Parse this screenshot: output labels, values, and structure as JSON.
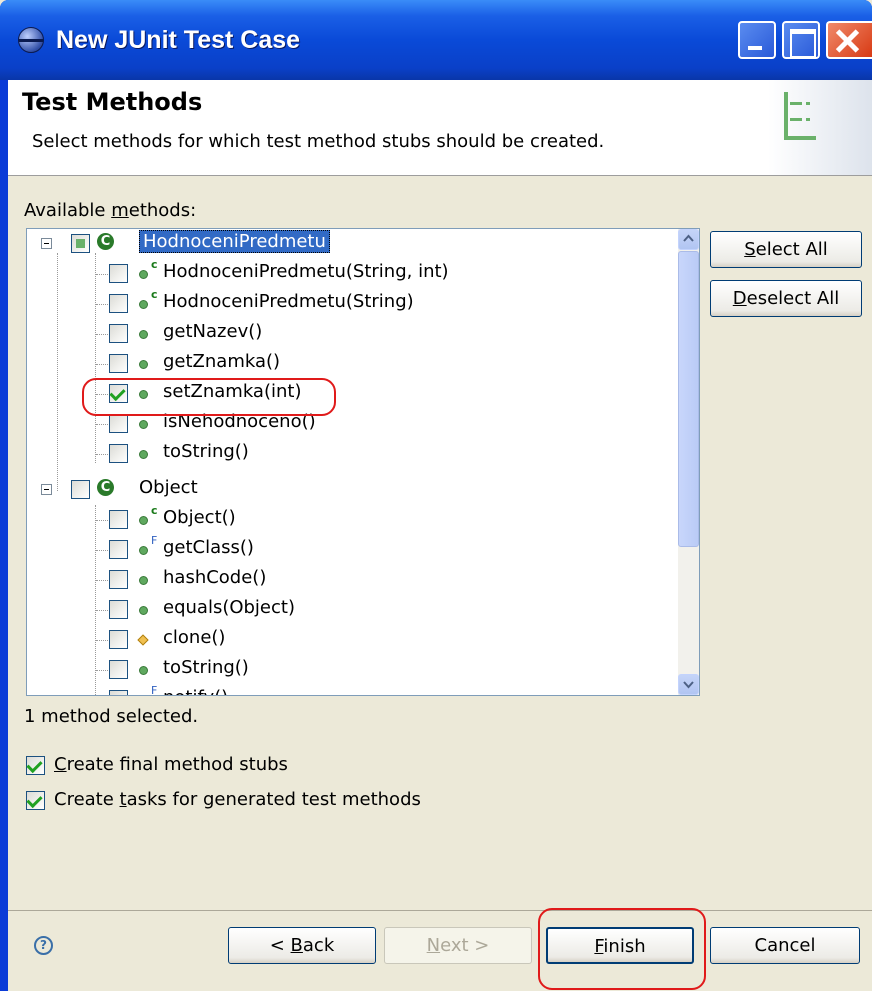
{
  "window": {
    "title": "New JUnit Test Case"
  },
  "header": {
    "title": "Test Methods",
    "description": "Select methods for which test method stubs should be created."
  },
  "available_label": {
    "before": "Available ",
    "mnemonic": "m",
    "after": "ethods:"
  },
  "tree": {
    "class1": {
      "name": "HodnoceniPredmetu",
      "icon_letter": "C"
    },
    "class1_methods": [
      {
        "label": "HodnoceniPredmetu(String, int)",
        "checked": false,
        "marker": "c"
      },
      {
        "label": "HodnoceniPredmetu(String)",
        "checked": false,
        "marker": "c"
      },
      {
        "label": "getNazev()",
        "checked": false
      },
      {
        "label": "getZnamka()",
        "checked": false
      },
      {
        "label": "setZnamka(int)",
        "checked": true
      },
      {
        "label": "isNehodnoceno()",
        "checked": false
      },
      {
        "label": "toString()",
        "checked": false
      }
    ],
    "class2": {
      "name": "Object",
      "icon_letter": "C"
    },
    "class2_methods": [
      {
        "label": "Object()",
        "checked": false,
        "marker": "c"
      },
      {
        "label": "getClass()",
        "checked": false,
        "marker": "F"
      },
      {
        "label": "hashCode()",
        "checked": false
      },
      {
        "label": "equals(Object)",
        "checked": false
      },
      {
        "label": "clone()",
        "checked": false,
        "icon": "protected"
      },
      {
        "label": "toString()",
        "checked": false
      },
      {
        "label": "notify()",
        "checked": false,
        "marker": "F"
      }
    ]
  },
  "buttons": {
    "select_all": {
      "mnemonic": "S",
      "rest": "elect All"
    },
    "deselect_all": {
      "mnemonic": "D",
      "rest": "eselect All"
    },
    "back": {
      "prefix": "< ",
      "mnemonic": "B",
      "rest": "ack"
    },
    "next": {
      "mnemonic": "N",
      "rest": "ext >"
    },
    "finish": {
      "mnemonic": "F",
      "rest": "inish"
    },
    "cancel": "Cancel"
  },
  "status": "1 method selected.",
  "options": {
    "final_stubs": {
      "mnemonic": "C",
      "rest": "reate final method stubs",
      "checked": true
    },
    "tasks": {
      "before": "Create ",
      "mnemonic": "t",
      "rest": "asks for generated test methods",
      "checked": true
    }
  },
  "help": {
    "glyph": "?"
  },
  "colors": {
    "titlebar": "#0a4ad8",
    "selection": "#316ac5",
    "annotation": "#e01a1a",
    "method_icon": "#5fa85f"
  }
}
